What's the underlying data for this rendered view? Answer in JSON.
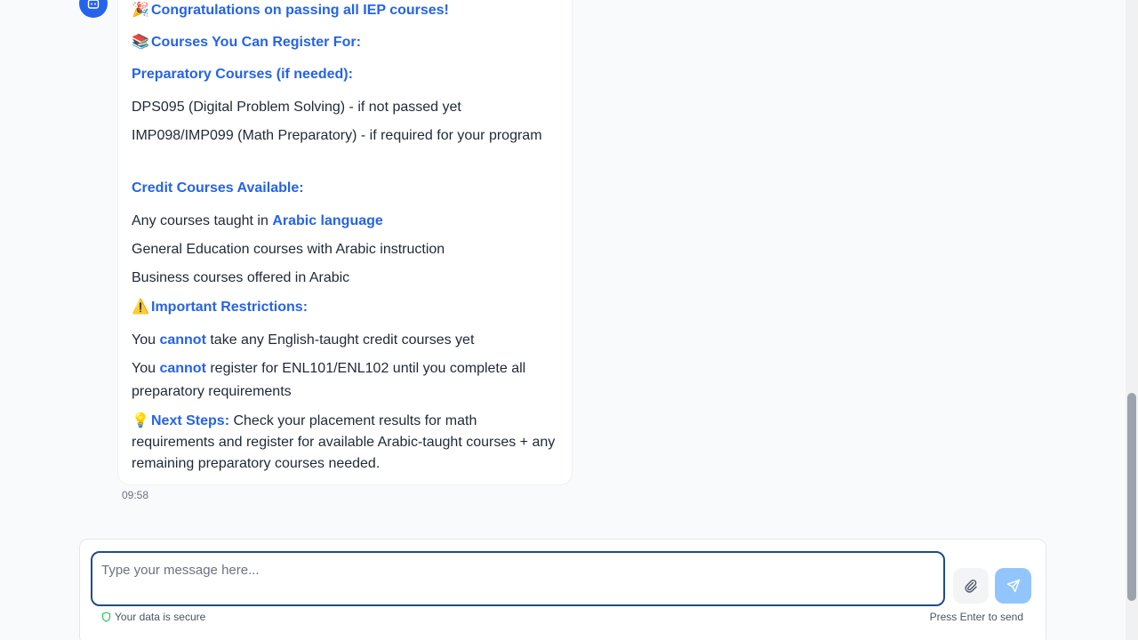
{
  "message": {
    "title_emoji": "🎉",
    "title": "Congratulations on passing all IEP courses!",
    "courses_emoji": "📚",
    "courses_heading": "Courses You Can Register For:",
    "prep_heading": "Preparatory Courses (if needed):",
    "prep_items": [
      "DPS095 (Digital Problem Solving) - if not passed yet",
      "IMP098/IMP099 (Math Preparatory) - if required for your program"
    ],
    "credit_heading": "Credit Courses Available:",
    "credit_item_1_prefix": "Any courses taught in ",
    "credit_item_1_highlight": "Arabic language",
    "credit_items": [
      "General Education courses with Arabic instruction",
      "Business courses offered in Arabic"
    ],
    "restrictions_emoji": "⚠️",
    "restrictions_heading": "Important Restrictions:",
    "restriction_1_prefix": "You ",
    "restriction_1_highlight": "cannot",
    "restriction_1_suffix": " take any English-taught credit courses yet",
    "restriction_2_prefix": "You ",
    "restriction_2_highlight": "cannot",
    "restriction_2_suffix": " register for ENL101/ENL102 until you complete all preparatory requirements",
    "next_emoji": "💡",
    "next_heading": "Next Steps:",
    "next_text": " Check your placement results for math requirements and register for available Arabic-taught courses + any remaining preparatory courses needed.",
    "timestamp": "09:58"
  },
  "composer": {
    "placeholder": "Type your message here...",
    "secure_note": "Your data is secure",
    "hint": "Press Enter to send"
  },
  "icons": {
    "avatar": "bot-icon",
    "attach": "paperclip-icon",
    "send": "send-icon",
    "secure": "shield-icon"
  },
  "colors": {
    "accent": "#2563eb",
    "send_button": "#93c5fd",
    "input_border": "#1d4e89"
  }
}
